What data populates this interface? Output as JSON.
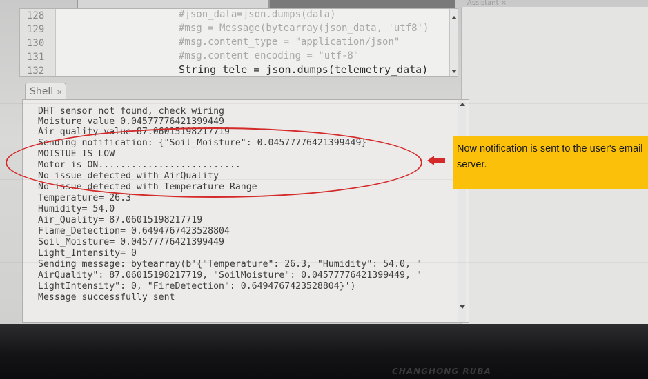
{
  "editor": {
    "line_numbers": [
      "128",
      "129",
      "130",
      "131",
      "132"
    ],
    "lines": [
      "#json_data=json.dumps(data)",
      "#msg = Message(bytearray(json_data, 'utf8')",
      "#msg.content_type = \"application/json\"",
      "#msg.content_encoding = \"utf-8\"",
      "String tele = json.dumps(telemetry_data)"
    ]
  },
  "right_pane": {
    "tab_label": "Assistant ×"
  },
  "shell": {
    "tab_label": "Shell",
    "tab_close": "×",
    "lines": [
      "DHT sensor not found, check wiring",
      "Moisture value 0.04577776421399449",
      "Air quality value 87.06015198217719",
      "Sending notification: {\"Soil_Moisture\": 0.04577776421399449}",
      "MOISTUE IS LOW",
      "Motor is ON..........................",
      "No issue detected with AirQuality",
      "No issue detected with Temperature Range",
      "Temperature= 26.3",
      "Humidity= 54.0",
      "Air_Quality= 87.06015198217719",
      "Flame_Detection= 0.6494767423528804",
      "Soil_Moisture= 0.04577776421399449",
      "Light_Intensity= 0",
      "Sending message: bytearray(b'{\"Temperature\": 26.3, \"Humidity\": 54.0, \"",
      "AirQuality\": 87.06015198217719, \"SoilMoisture\": 0.04577776421399449, \"",
      "LightIntensity\": 0, \"FireDetection\": 0.6494767423528804}')",
      "Message successfully sent"
    ]
  },
  "annotation": {
    "note": "Now notification is sent to the user's email server.",
    "color": "#fbc10a",
    "marker_color": "#d42a2a"
  },
  "monitor": {
    "brand": "CHANGHONG RUBA"
  }
}
